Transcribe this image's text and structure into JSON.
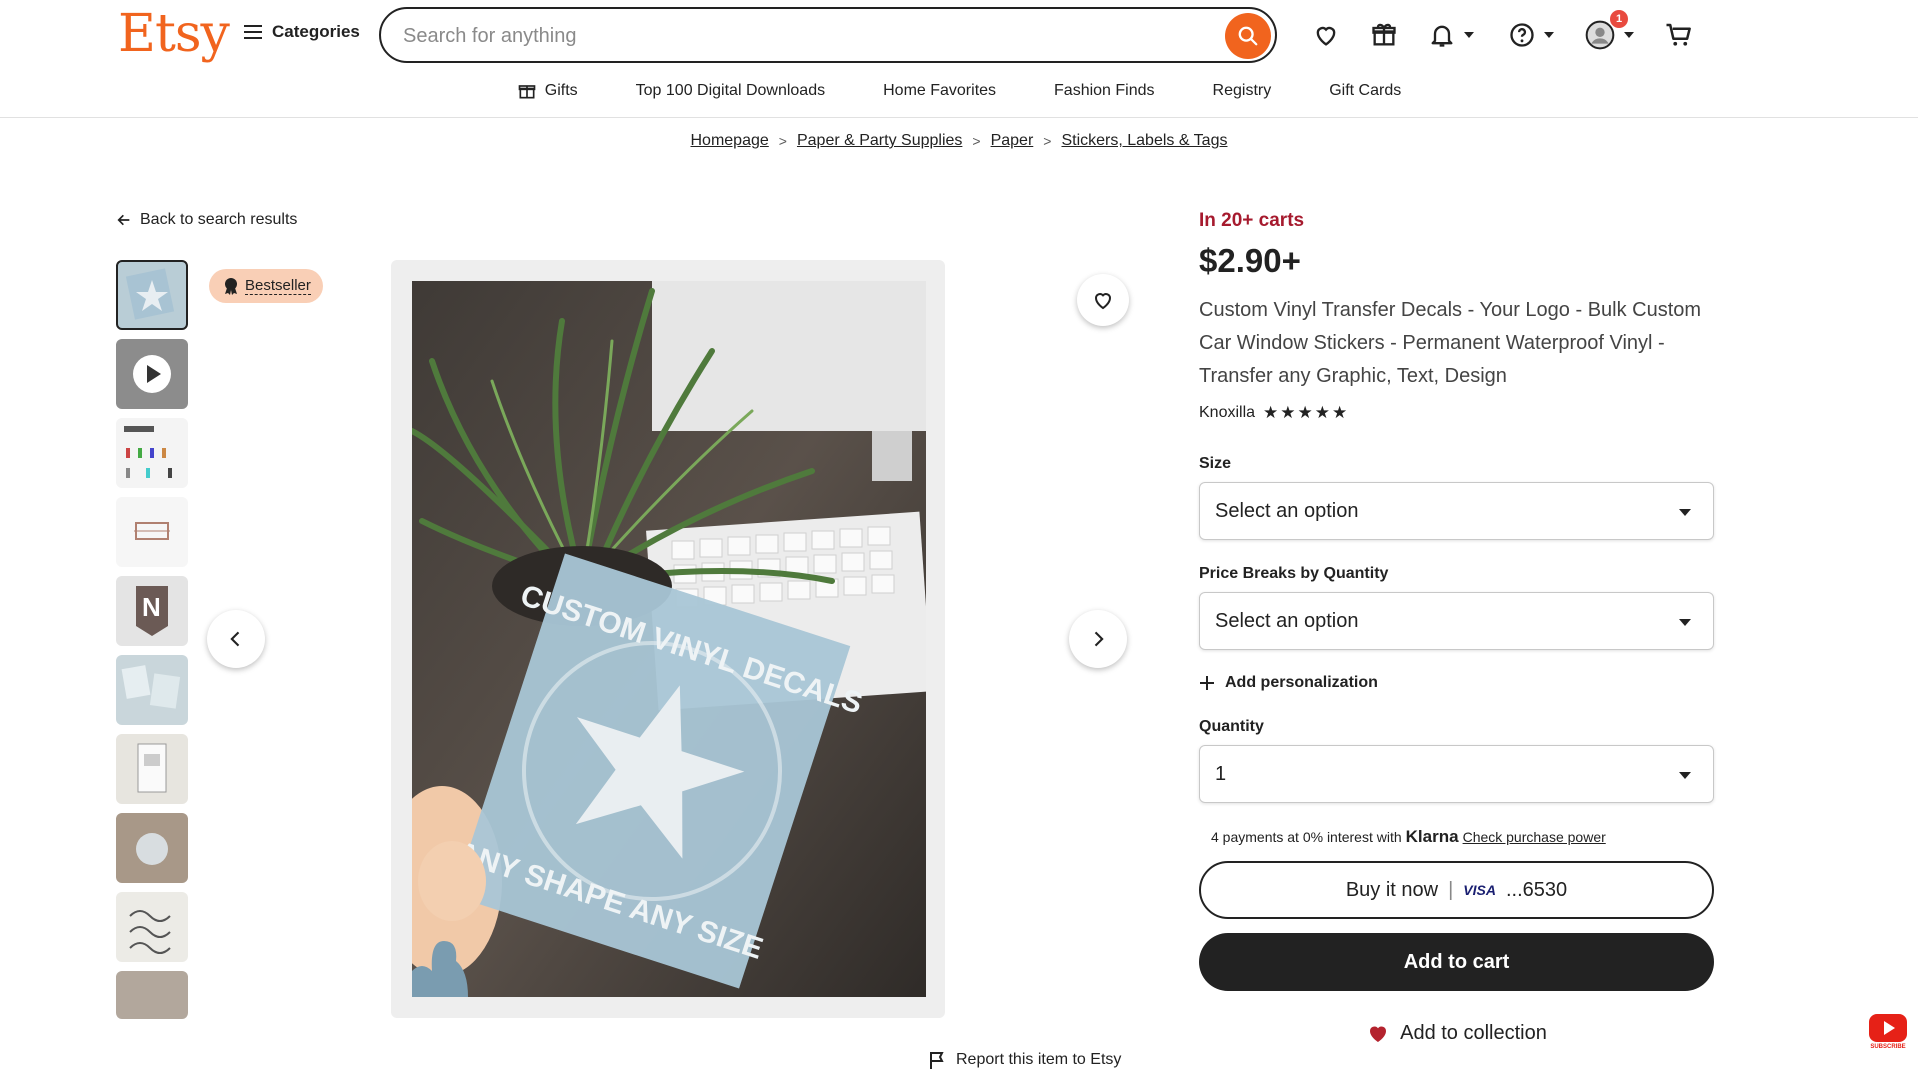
{
  "header": {
    "logo": "Etsy",
    "categories_label": "Categories",
    "search_placeholder": "Search for anything",
    "notification_count": "1"
  },
  "subnav": {
    "items": [
      "Gifts",
      "Top 100 Digital Downloads",
      "Home Favorites",
      "Fashion Finds",
      "Registry",
      "Gift Cards"
    ]
  },
  "breadcrumb": [
    "Homepage",
    "Paper & Party Supplies",
    "Paper",
    "Stickers, Labels & Tags"
  ],
  "gallery": {
    "back_label": "Back to search results",
    "badge_label": "Bestseller",
    "photo_text_top": "CUSTOM VINYL DECALS",
    "photo_text_bottom": "ANY SHAPE ANY SIZE"
  },
  "report_label": "Report this item to Etsy",
  "product": {
    "in_carts": "In 20+ carts",
    "price": "$2.90+",
    "title": "Custom Vinyl Transfer Decals - Your Logo - Bulk Custom Car Window Stickers - Permanent Waterproof Vinyl - Transfer any Graphic, Text, Design",
    "shop_name": "Knoxilla",
    "stars": "★★★★★",
    "size_label": "Size",
    "size_value": "Select an option",
    "price_breaks_label": "Price Breaks by Quantity",
    "price_breaks_value": "Select an option",
    "add_personalization": "Add personalization",
    "quantity_label": "Quantity",
    "quantity_value": "1",
    "klarna_prefix": "4 payments at 0% interest with",
    "klarna_brand": "Klarna",
    "klarna_link": "Check purchase power",
    "buy_now": "Buy it now",
    "card_brand": "VISA",
    "card_last4": "...6530",
    "add_to_cart": "Add to cart",
    "add_to_collection": "Add to collection"
  },
  "youtube": {
    "label": "SUBSCRIBE"
  },
  "colors": {
    "brand": "#f1641e",
    "cart_alert": "#a61a2e",
    "badge_bg": "#f9cfb6"
  }
}
